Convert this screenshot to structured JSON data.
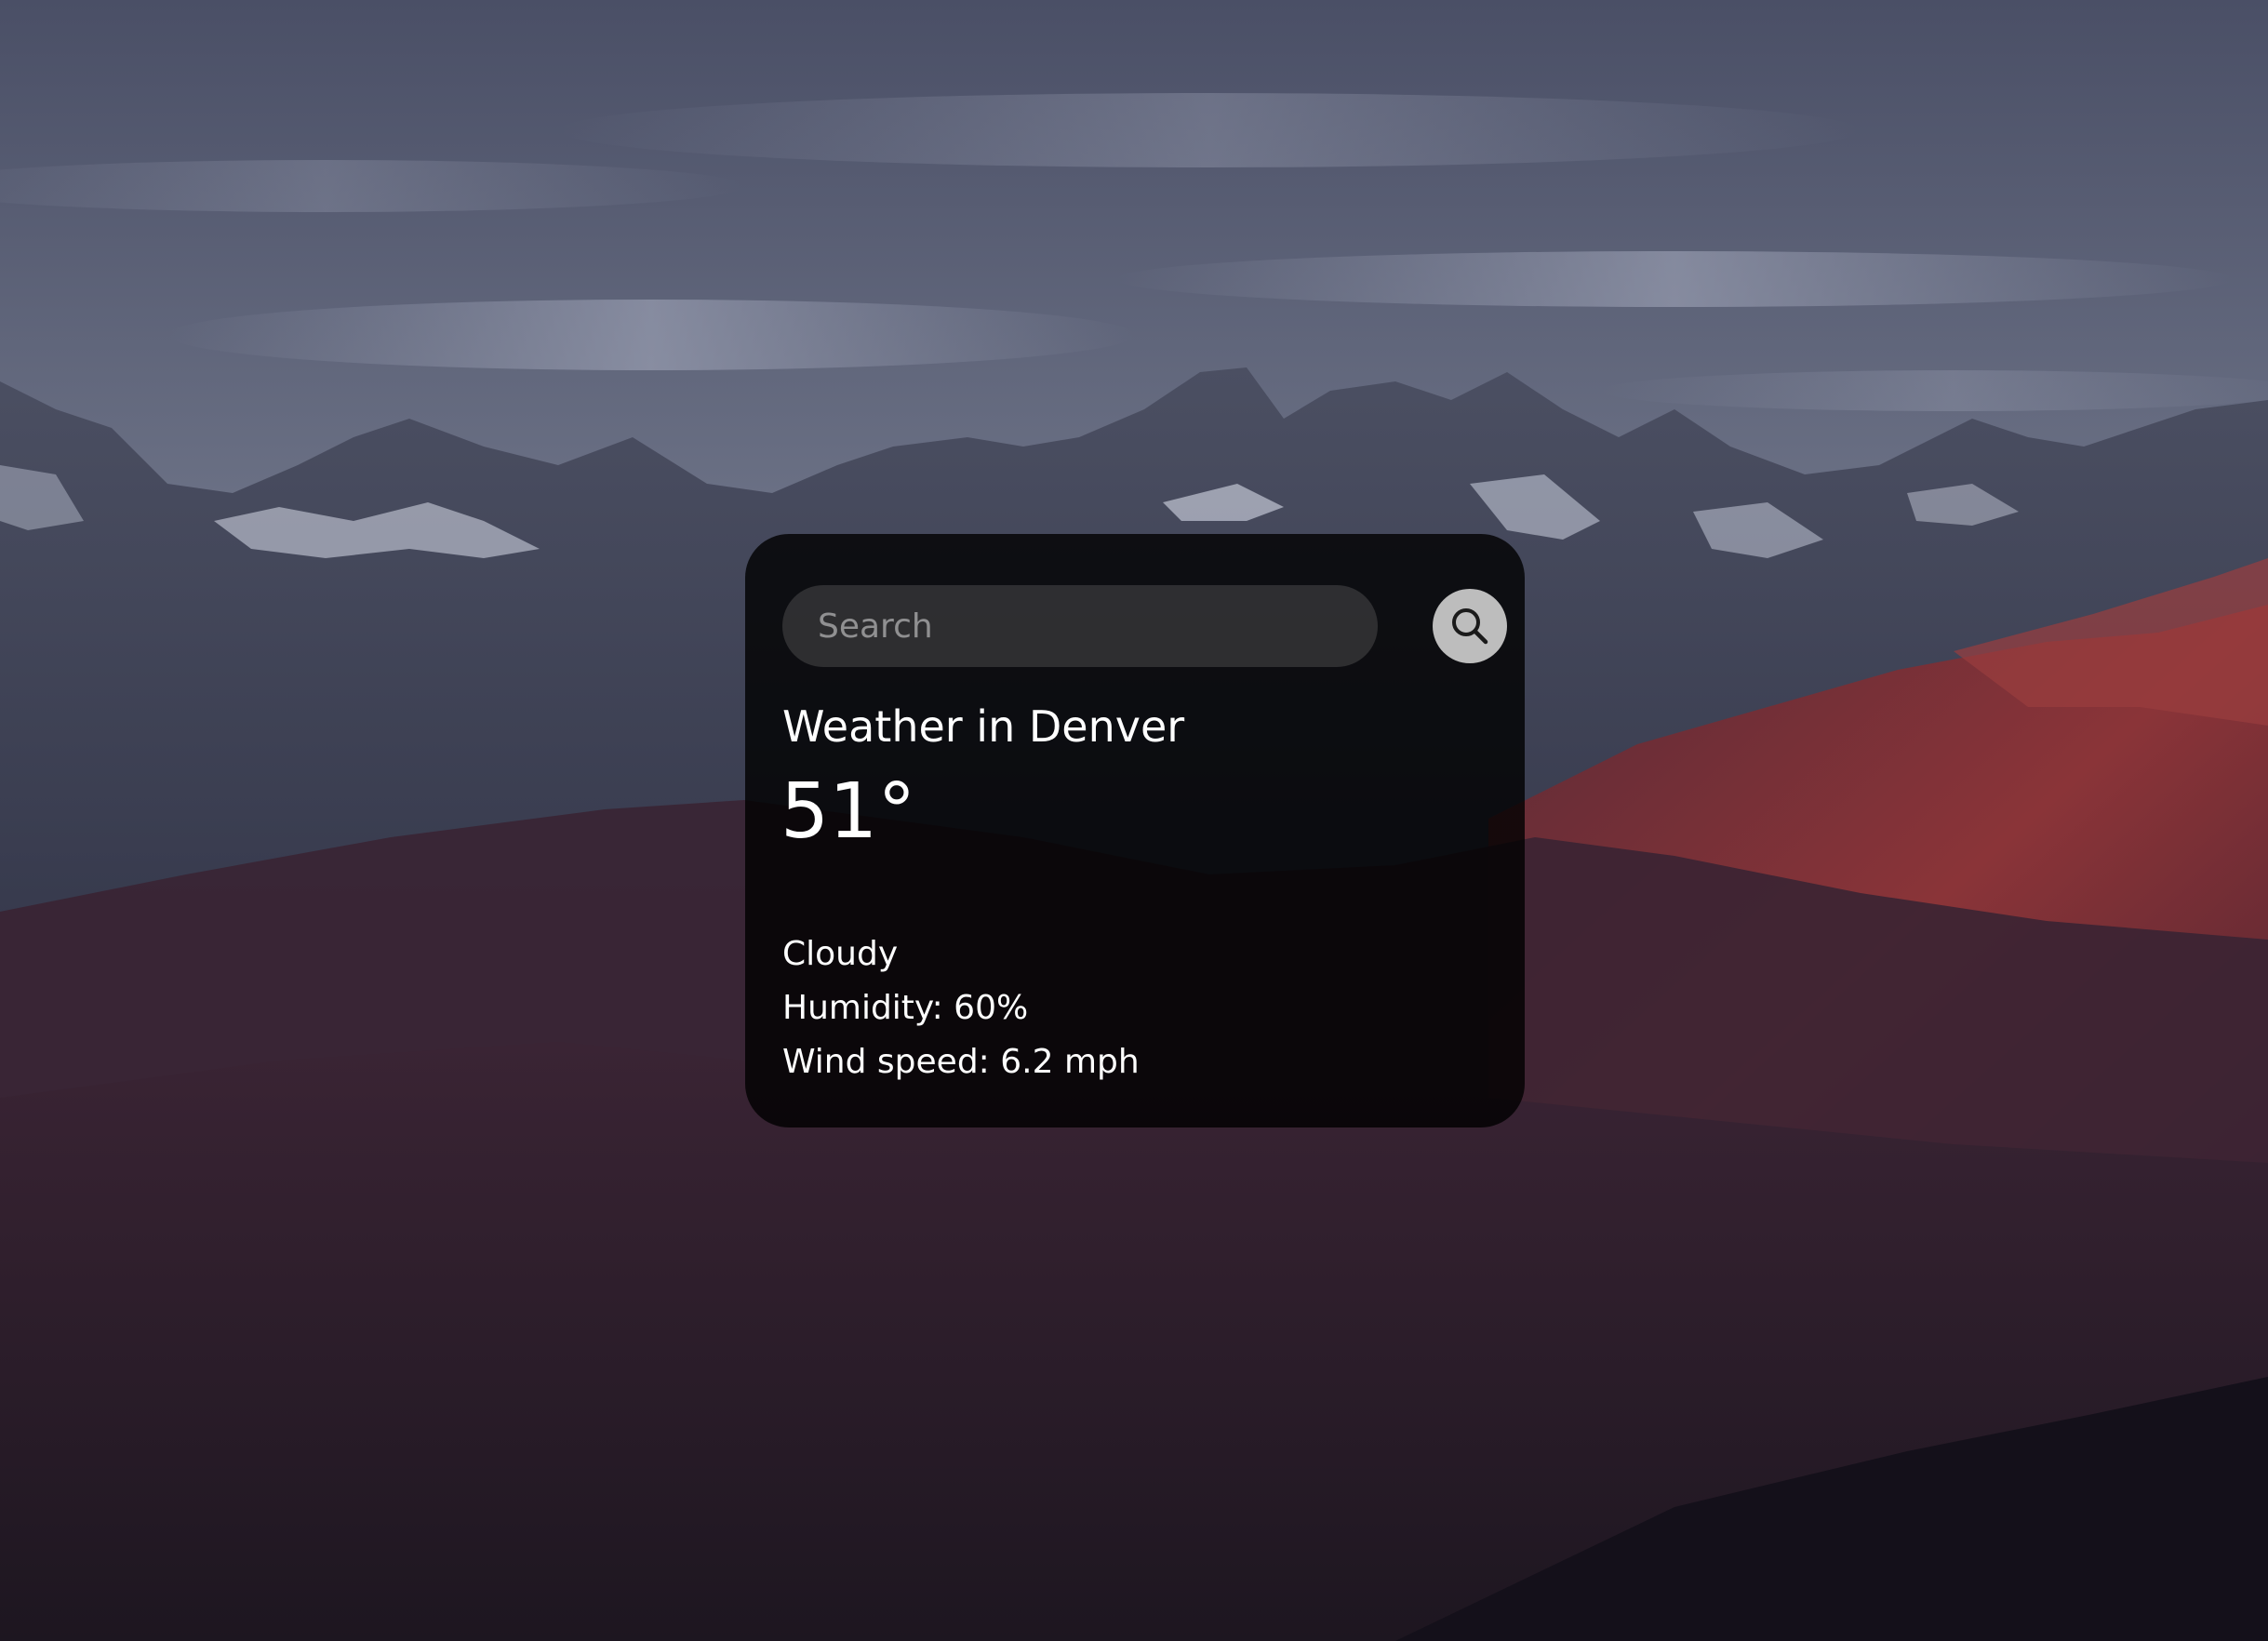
{
  "background": {
    "description_icon": "mountain-landscape-background",
    "sky_color": "#6f7589",
    "mountain_color": "#2e2535",
    "sunlit_color": "#8a3438"
  },
  "search": {
    "placeholder": "Search",
    "value": "",
    "button_icon": "search-icon",
    "button_color": "#bdbdbd"
  },
  "weather": {
    "title": "Weather in Denver",
    "temperature": "51°",
    "condition": "Cloudy",
    "humidity": "Humidity: 60%",
    "wind": "Wind speed: 6.2 mph"
  }
}
